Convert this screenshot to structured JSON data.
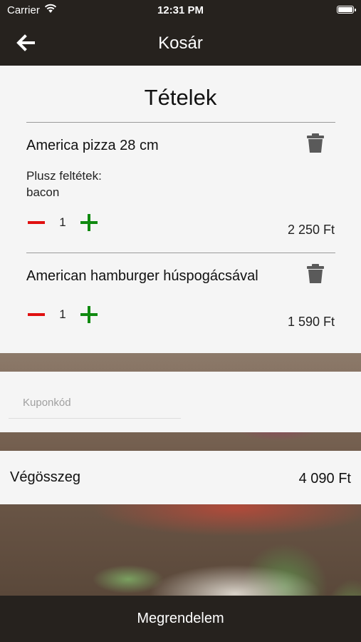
{
  "status_bar": {
    "carrier": "Carrier",
    "time": "12:31 PM"
  },
  "header": {
    "title": "Kosár",
    "back_icon": "arrow-left-icon"
  },
  "items_section": {
    "heading": "Tételek",
    "items": [
      {
        "name": "America pizza 28 cm",
        "extras_label": "Plusz feltétek:",
        "extras_value": "bacon",
        "quantity": "1",
        "price": "2 250 Ft"
      },
      {
        "name": "American hamburger húspogácsával",
        "quantity": "1",
        "price": "1 590 Ft"
      }
    ]
  },
  "coupon": {
    "placeholder": "Kuponkód",
    "value": ""
  },
  "total": {
    "label": "Végösszeg",
    "value": "4 090 Ft"
  },
  "order_button": {
    "label": "Megrendelem"
  },
  "colors": {
    "bar": "#26221e",
    "minus": "#e01010",
    "plus": "#108a10",
    "trash": "#5a5a5a",
    "card": "#f5f5f5"
  }
}
